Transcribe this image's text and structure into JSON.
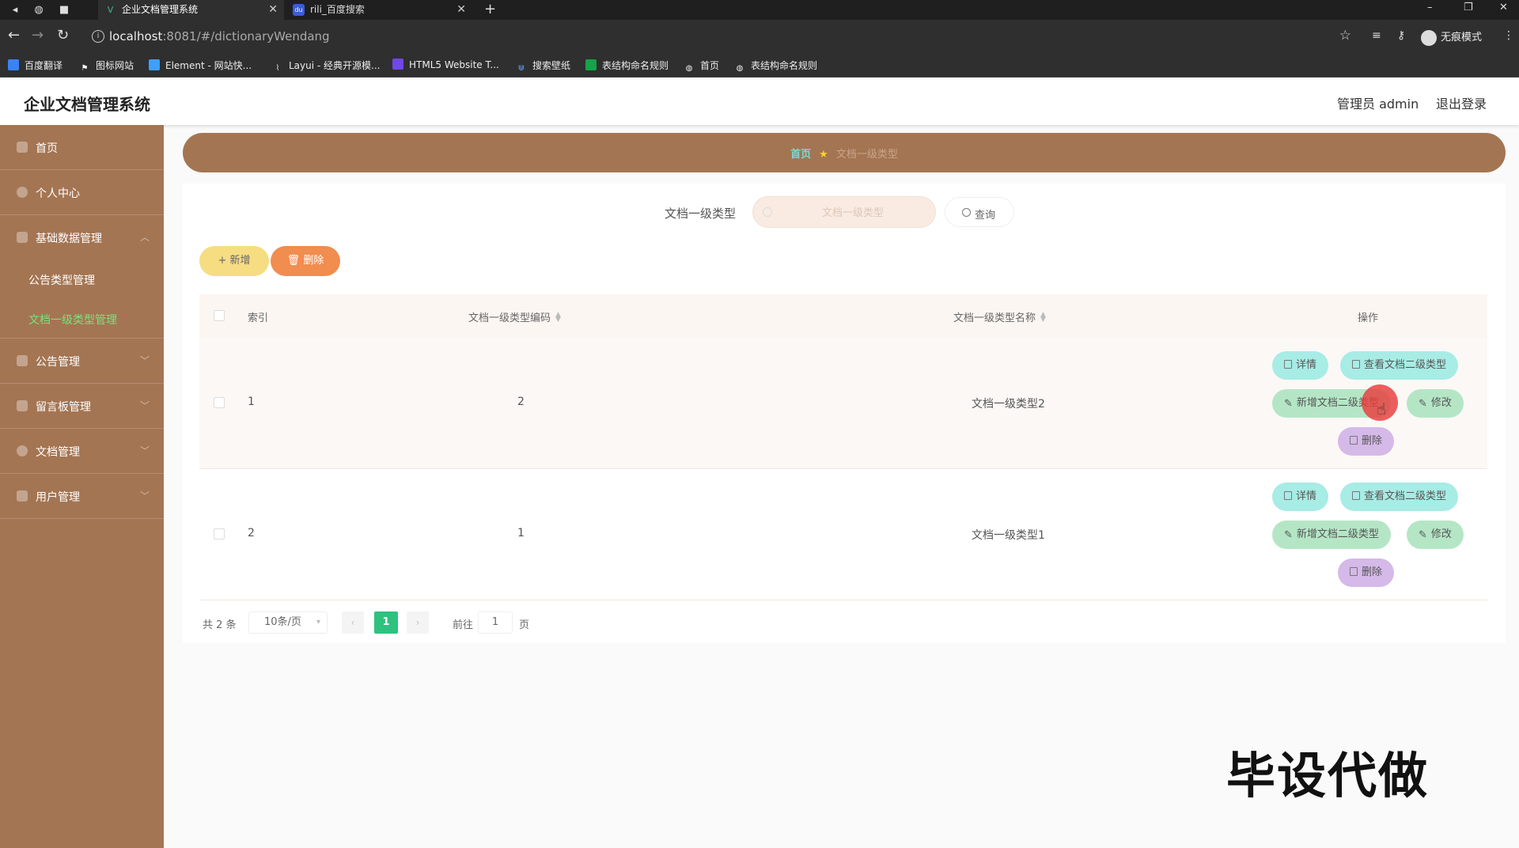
{
  "browser": {
    "tabs": [
      {
        "title": "企业文档管理系统",
        "favicon": "V",
        "favicon_color": "#42b883"
      },
      {
        "title": "rili_百度搜索",
        "favicon": "du",
        "favicon_color": "#3b5bdb"
      }
    ],
    "url_host": "localhost",
    "url_rest": ":8081/#/dictionaryWendang",
    "profile_label": "无痕模式",
    "bookmarks": [
      "百度翻译",
      "图标网站",
      "Element - 网站快...",
      "Layui - 经典开源模...",
      "HTML5 Website T...",
      "搜索壁纸",
      "表结构命名规则",
      "首页",
      "表结构命名规则"
    ]
  },
  "header": {
    "title": "企业文档管理系统",
    "admin_label": "管理员 admin",
    "logout_label": "退出登录"
  },
  "sidebar": {
    "items": [
      {
        "label": "首页"
      },
      {
        "label": "个人中心"
      },
      {
        "label": "基础数据管理"
      },
      {
        "label": "公告管理"
      },
      {
        "label": "留言板管理"
      },
      {
        "label": "文档管理"
      },
      {
        "label": "用户管理"
      }
    ],
    "sub_items": [
      {
        "label": "公告类型管理"
      },
      {
        "label": "文档一级类型管理"
      }
    ]
  },
  "breadcrumb": {
    "home": "首页",
    "current": "文档一级类型"
  },
  "search": {
    "label": "文档一级类型",
    "placeholder": "文档一级类型",
    "button_label": "查询"
  },
  "toolbar": {
    "add_label": "+ 新增",
    "delete_label": "删除"
  },
  "table": {
    "columns": [
      "索引",
      "文档一级类型编码",
      "文档一级类型名称",
      "操作"
    ],
    "rows": [
      {
        "index": "1",
        "code": "2",
        "name": "文档一级类型2"
      },
      {
        "index": "2",
        "code": "1",
        "name": "文档一级类型1"
      }
    ],
    "actions": {
      "detail": "详情",
      "view_sub": "查看文档二级类型",
      "add_sub": "新增文档二级类型",
      "edit": "修改",
      "delete": "删除"
    }
  },
  "pagination": {
    "total_label": "共 2 条",
    "page_size": "10条/页",
    "current_page": "1",
    "goto_label": "前往",
    "goto_value": "1",
    "page_suffix": "页",
    "prev_icon": "‹",
    "next_icon": "›"
  },
  "watermark": "毕设代做",
  "colors": {
    "sidebar": "#a47553",
    "accent_green": "#2ec27e",
    "btn_add": "#f6dd82",
    "btn_delete": "#f08d4f",
    "op_cyan": "#a7ece5",
    "op_green": "#b4e6c6",
    "op_purple": "#d5b9e8"
  }
}
